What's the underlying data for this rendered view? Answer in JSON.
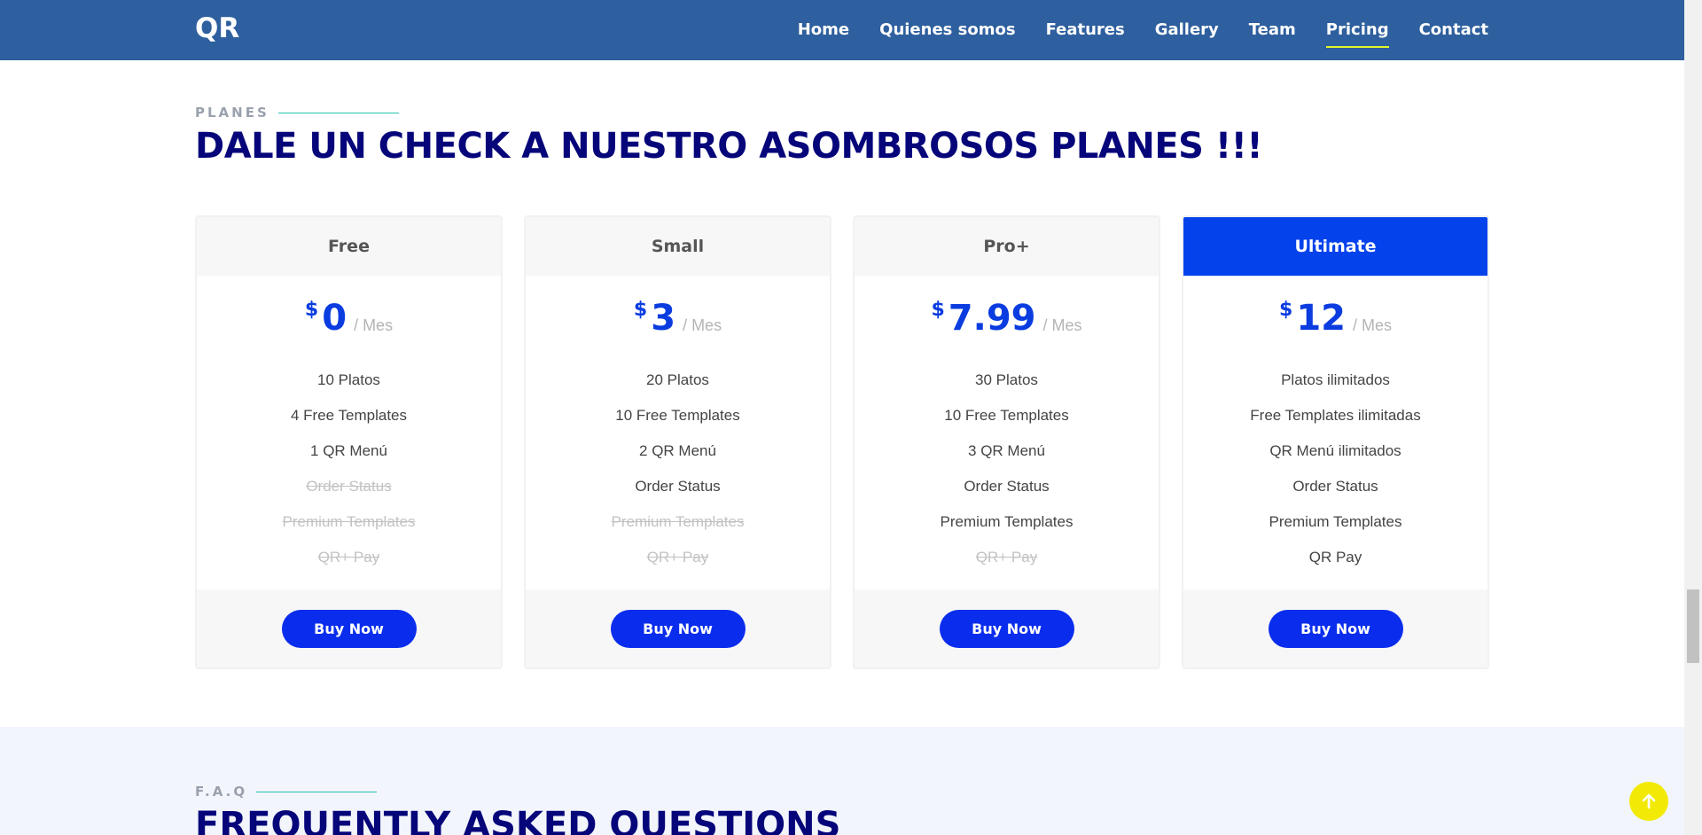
{
  "header": {
    "logo": "QR",
    "nav": [
      {
        "label": "Home",
        "active": false
      },
      {
        "label": "Quienes somos",
        "active": false
      },
      {
        "label": "Features",
        "active": false
      },
      {
        "label": "Gallery",
        "active": false
      },
      {
        "label": "Team",
        "active": false
      },
      {
        "label": "Pricing",
        "active": true
      },
      {
        "label": "Contact",
        "active": false
      }
    ]
  },
  "pricing": {
    "label": "PLANES",
    "title": "DALE UN CHECK A NUESTRO ASOMBROSOS PLANES !!!",
    "plans": [
      {
        "name": "Free",
        "currency": "$",
        "amount": "0",
        "period": "/ Mes",
        "featured": false,
        "features": [
          {
            "text": "10 Platos",
            "available": true
          },
          {
            "text": "4 Free Templates",
            "available": true
          },
          {
            "text": "1 QR Menú",
            "available": true
          },
          {
            "text": "Order Status",
            "available": false
          },
          {
            "text": "Premium Templates",
            "available": false
          },
          {
            "text": "QR+ Pay",
            "available": false
          }
        ],
        "button": "Buy Now"
      },
      {
        "name": "Small",
        "currency": "$",
        "amount": "3",
        "period": "/ Mes",
        "featured": false,
        "features": [
          {
            "text": "20 Platos",
            "available": true
          },
          {
            "text": "10 Free Templates",
            "available": true
          },
          {
            "text": "2 QR Menú",
            "available": true
          },
          {
            "text": "Order Status",
            "available": true
          },
          {
            "text": "Premium Templates",
            "available": false
          },
          {
            "text": "QR+ Pay",
            "available": false
          }
        ],
        "button": "Buy Now"
      },
      {
        "name": "Pro+",
        "currency": "$",
        "amount": "7.99",
        "period": "/ Mes",
        "featured": false,
        "features": [
          {
            "text": "30 Platos",
            "available": true
          },
          {
            "text": "10 Free Templates",
            "available": true
          },
          {
            "text": "3 QR Menú",
            "available": true
          },
          {
            "text": "Order Status",
            "available": true
          },
          {
            "text": "Premium Templates",
            "available": true
          },
          {
            "text": "QR+ Pay",
            "available": false
          }
        ],
        "button": "Buy Now"
      },
      {
        "name": "Ultimate",
        "currency": "$",
        "amount": "12",
        "period": "/ Mes",
        "featured": true,
        "features": [
          {
            "text": "Platos ilimitados",
            "available": true
          },
          {
            "text": "Free Templates ilimitadas",
            "available": true
          },
          {
            "text": "QR Menú ilimitados",
            "available": true
          },
          {
            "text": "Order Status",
            "available": true
          },
          {
            "text": "Premium Templates",
            "available": true
          },
          {
            "text": "QR Pay",
            "available": true
          }
        ],
        "button": "Buy Now"
      }
    ]
  },
  "faq": {
    "label": "F.A.Q",
    "title": "FREQUENTLY ASKED QUESTIONS"
  },
  "back_to_top_icon": "arrow-up-icon",
  "colors": {
    "header_bg": "#2e5f9e",
    "accent_blue": "#0442ec",
    "title_navy": "#06067a",
    "nav_active_underline": "#e3f52a",
    "back_to_top": "#f2ea06"
  }
}
